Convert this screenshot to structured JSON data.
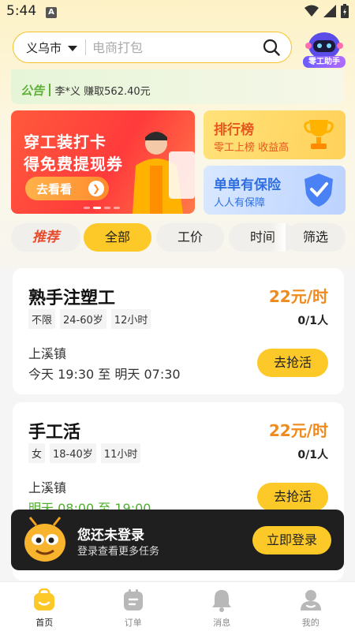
{
  "status_bar": {
    "time": "5:44",
    "indicator": "A"
  },
  "search": {
    "city": "义乌市",
    "placeholder": "电商打包"
  },
  "assistant": {
    "label": "零工助手"
  },
  "notice": {
    "tag": "公告",
    "text": "李*义 赚取562.40元"
  },
  "banners": {
    "main": {
      "line1": "穿工装打卡",
      "line2": "得免费提现券",
      "button": "去看看"
    },
    "rank": {
      "title": "排行榜",
      "subtitle": "零工上榜 收益高"
    },
    "insurance": {
      "title": "单单有保险",
      "subtitle": "人人有保障"
    }
  },
  "tabs": [
    {
      "label": "推荐"
    },
    {
      "label": "全部"
    },
    {
      "label": "工价"
    },
    {
      "label": "时间"
    },
    {
      "label": "筛选"
    }
  ],
  "jobs": [
    {
      "title": "熟手注塑工",
      "wage": "22元/时",
      "tags": [
        "不限",
        "24-60岁",
        "12小时"
      ],
      "count": "0/1人",
      "place": "上溪镇",
      "time": "今天 19:30 至 明天 07:30",
      "button": "去抢活"
    },
    {
      "title": "手工活",
      "wage": "22元/时",
      "tags": [
        "女",
        "18-40岁",
        "11小时"
      ],
      "count": "0/1人",
      "place": "上溪镇",
      "time": "明天 08:00 至 19:00",
      "button": "去抢活"
    }
  ],
  "login": {
    "title": "您还未登录",
    "subtitle": "登录查看更多任务",
    "button": "立即登录"
  },
  "nav": [
    {
      "label": "首页",
      "icon": "home-icon"
    },
    {
      "label": "订单",
      "icon": "order-icon"
    },
    {
      "label": "消息",
      "icon": "bell-icon"
    },
    {
      "label": "我的",
      "icon": "profile-icon"
    }
  ],
  "colors": {
    "accent": "#fcc928",
    "wage": "#f08a1c",
    "green": "#4caf2a",
    "notice": "#5fb03a"
  }
}
